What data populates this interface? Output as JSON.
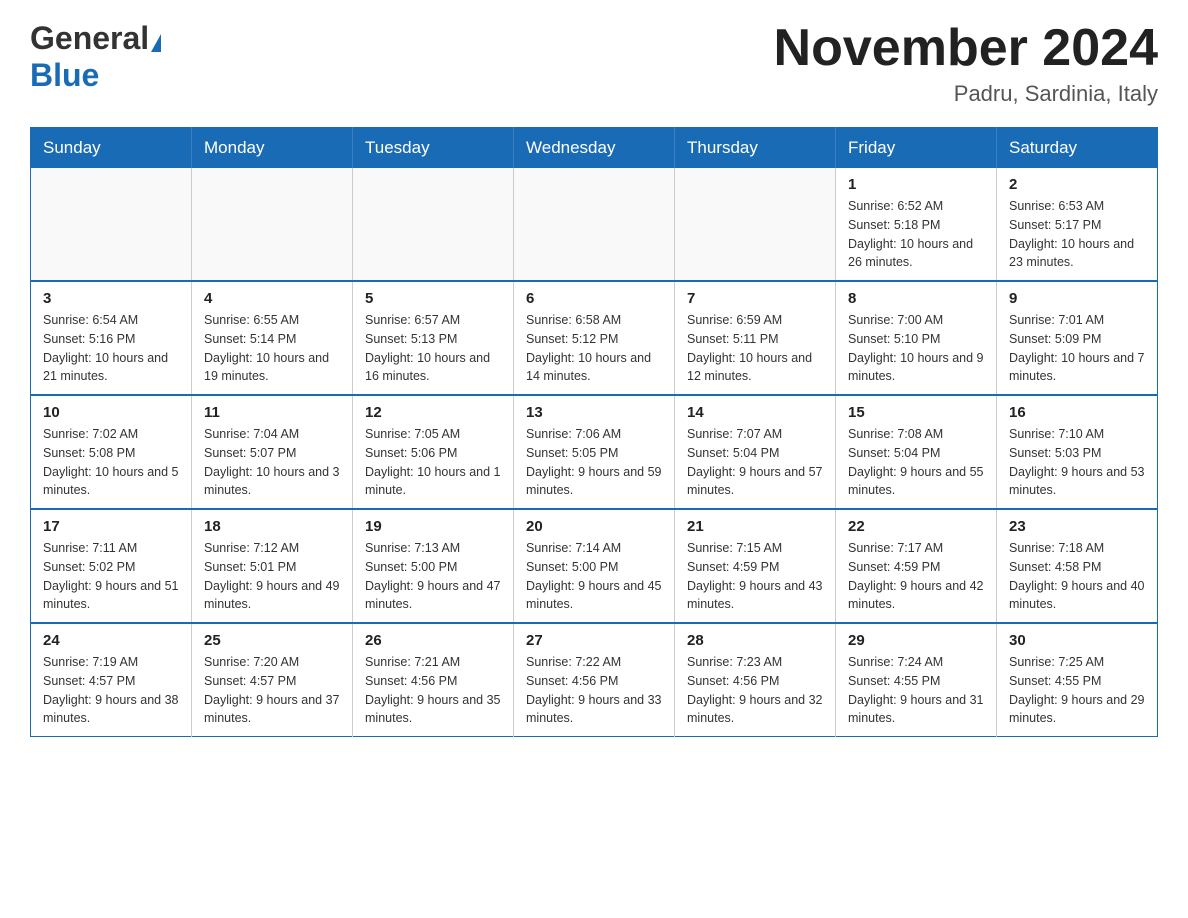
{
  "header": {
    "logo_general": "General",
    "logo_blue": "Blue",
    "month_title": "November 2024",
    "location": "Padru, Sardinia, Italy"
  },
  "weekdays": [
    "Sunday",
    "Monday",
    "Tuesday",
    "Wednesday",
    "Thursday",
    "Friday",
    "Saturday"
  ],
  "weeks": [
    [
      {
        "day": "",
        "sunrise": "",
        "sunset": "",
        "daylight": ""
      },
      {
        "day": "",
        "sunrise": "",
        "sunset": "",
        "daylight": ""
      },
      {
        "day": "",
        "sunrise": "",
        "sunset": "",
        "daylight": ""
      },
      {
        "day": "",
        "sunrise": "",
        "sunset": "",
        "daylight": ""
      },
      {
        "day": "",
        "sunrise": "",
        "sunset": "",
        "daylight": ""
      },
      {
        "day": "1",
        "sunrise": "Sunrise: 6:52 AM",
        "sunset": "Sunset: 5:18 PM",
        "daylight": "Daylight: 10 hours and 26 minutes."
      },
      {
        "day": "2",
        "sunrise": "Sunrise: 6:53 AM",
        "sunset": "Sunset: 5:17 PM",
        "daylight": "Daylight: 10 hours and 23 minutes."
      }
    ],
    [
      {
        "day": "3",
        "sunrise": "Sunrise: 6:54 AM",
        "sunset": "Sunset: 5:16 PM",
        "daylight": "Daylight: 10 hours and 21 minutes."
      },
      {
        "day": "4",
        "sunrise": "Sunrise: 6:55 AM",
        "sunset": "Sunset: 5:14 PM",
        "daylight": "Daylight: 10 hours and 19 minutes."
      },
      {
        "day": "5",
        "sunrise": "Sunrise: 6:57 AM",
        "sunset": "Sunset: 5:13 PM",
        "daylight": "Daylight: 10 hours and 16 minutes."
      },
      {
        "day": "6",
        "sunrise": "Sunrise: 6:58 AM",
        "sunset": "Sunset: 5:12 PM",
        "daylight": "Daylight: 10 hours and 14 minutes."
      },
      {
        "day": "7",
        "sunrise": "Sunrise: 6:59 AM",
        "sunset": "Sunset: 5:11 PM",
        "daylight": "Daylight: 10 hours and 12 minutes."
      },
      {
        "day": "8",
        "sunrise": "Sunrise: 7:00 AM",
        "sunset": "Sunset: 5:10 PM",
        "daylight": "Daylight: 10 hours and 9 minutes."
      },
      {
        "day": "9",
        "sunrise": "Sunrise: 7:01 AM",
        "sunset": "Sunset: 5:09 PM",
        "daylight": "Daylight: 10 hours and 7 minutes."
      }
    ],
    [
      {
        "day": "10",
        "sunrise": "Sunrise: 7:02 AM",
        "sunset": "Sunset: 5:08 PM",
        "daylight": "Daylight: 10 hours and 5 minutes."
      },
      {
        "day": "11",
        "sunrise": "Sunrise: 7:04 AM",
        "sunset": "Sunset: 5:07 PM",
        "daylight": "Daylight: 10 hours and 3 minutes."
      },
      {
        "day": "12",
        "sunrise": "Sunrise: 7:05 AM",
        "sunset": "Sunset: 5:06 PM",
        "daylight": "Daylight: 10 hours and 1 minute."
      },
      {
        "day": "13",
        "sunrise": "Sunrise: 7:06 AM",
        "sunset": "Sunset: 5:05 PM",
        "daylight": "Daylight: 9 hours and 59 minutes."
      },
      {
        "day": "14",
        "sunrise": "Sunrise: 7:07 AM",
        "sunset": "Sunset: 5:04 PM",
        "daylight": "Daylight: 9 hours and 57 minutes."
      },
      {
        "day": "15",
        "sunrise": "Sunrise: 7:08 AM",
        "sunset": "Sunset: 5:04 PM",
        "daylight": "Daylight: 9 hours and 55 minutes."
      },
      {
        "day": "16",
        "sunrise": "Sunrise: 7:10 AM",
        "sunset": "Sunset: 5:03 PM",
        "daylight": "Daylight: 9 hours and 53 minutes."
      }
    ],
    [
      {
        "day": "17",
        "sunrise": "Sunrise: 7:11 AM",
        "sunset": "Sunset: 5:02 PM",
        "daylight": "Daylight: 9 hours and 51 minutes."
      },
      {
        "day": "18",
        "sunrise": "Sunrise: 7:12 AM",
        "sunset": "Sunset: 5:01 PM",
        "daylight": "Daylight: 9 hours and 49 minutes."
      },
      {
        "day": "19",
        "sunrise": "Sunrise: 7:13 AM",
        "sunset": "Sunset: 5:00 PM",
        "daylight": "Daylight: 9 hours and 47 minutes."
      },
      {
        "day": "20",
        "sunrise": "Sunrise: 7:14 AM",
        "sunset": "Sunset: 5:00 PM",
        "daylight": "Daylight: 9 hours and 45 minutes."
      },
      {
        "day": "21",
        "sunrise": "Sunrise: 7:15 AM",
        "sunset": "Sunset: 4:59 PM",
        "daylight": "Daylight: 9 hours and 43 minutes."
      },
      {
        "day": "22",
        "sunrise": "Sunrise: 7:17 AM",
        "sunset": "Sunset: 4:59 PM",
        "daylight": "Daylight: 9 hours and 42 minutes."
      },
      {
        "day": "23",
        "sunrise": "Sunrise: 7:18 AM",
        "sunset": "Sunset: 4:58 PM",
        "daylight": "Daylight: 9 hours and 40 minutes."
      }
    ],
    [
      {
        "day": "24",
        "sunrise": "Sunrise: 7:19 AM",
        "sunset": "Sunset: 4:57 PM",
        "daylight": "Daylight: 9 hours and 38 minutes."
      },
      {
        "day": "25",
        "sunrise": "Sunrise: 7:20 AM",
        "sunset": "Sunset: 4:57 PM",
        "daylight": "Daylight: 9 hours and 37 minutes."
      },
      {
        "day": "26",
        "sunrise": "Sunrise: 7:21 AM",
        "sunset": "Sunset: 4:56 PM",
        "daylight": "Daylight: 9 hours and 35 minutes."
      },
      {
        "day": "27",
        "sunrise": "Sunrise: 7:22 AM",
        "sunset": "Sunset: 4:56 PM",
        "daylight": "Daylight: 9 hours and 33 minutes."
      },
      {
        "day": "28",
        "sunrise": "Sunrise: 7:23 AM",
        "sunset": "Sunset: 4:56 PM",
        "daylight": "Daylight: 9 hours and 32 minutes."
      },
      {
        "day": "29",
        "sunrise": "Sunrise: 7:24 AM",
        "sunset": "Sunset: 4:55 PM",
        "daylight": "Daylight: 9 hours and 31 minutes."
      },
      {
        "day": "30",
        "sunrise": "Sunrise: 7:25 AM",
        "sunset": "Sunset: 4:55 PM",
        "daylight": "Daylight: 9 hours and 29 minutes."
      }
    ]
  ]
}
